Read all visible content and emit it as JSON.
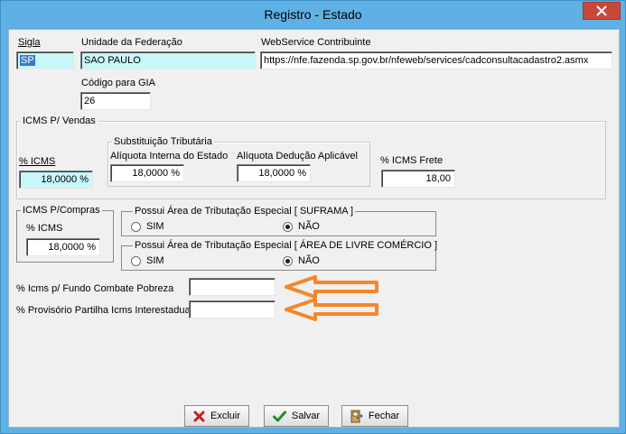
{
  "window": {
    "title": "Registro - Estado"
  },
  "fields": {
    "sigla": {
      "label": "Sigla",
      "value": "SP"
    },
    "uf": {
      "label": "Unidade da Federação",
      "value": "SAO PAULO"
    },
    "webservice": {
      "label": "WebService Contribuinte",
      "value": "https://nfe.fazenda.sp.gov.br/nfeweb/services/cadconsultacadastro2.asmx"
    },
    "codigo_gia": {
      "label": "Código para GIA",
      "value": "26"
    }
  },
  "icms_vendas": {
    "legend": "ICMS P/ Vendas",
    "pct_icms": {
      "label": "% ICMS",
      "value": "18,0000 %"
    },
    "subst": {
      "legend": "Substituição Tributária",
      "aliquota_interna": {
        "label": "Alíquota Interna do Estado",
        "value": "18,0000 %"
      },
      "aliquota_deducao": {
        "label": "Alíquota Dedução Aplicável",
        "value": "18,0000 %"
      }
    },
    "icms_frete": {
      "label": "% ICMS Frete",
      "value": "18,00"
    }
  },
  "icms_compras": {
    "legend": "ICMS P/Compras",
    "pct_icms": {
      "label": "% ICMS",
      "value": "18,0000 %"
    }
  },
  "suframa": {
    "legend": "Possui Área de Tributação Especial [ SUFRAMA ]",
    "sim": "SIM",
    "nao": "NÃO",
    "selected": "nao"
  },
  "livre_comercio": {
    "legend": "Possui Área de Tributação Especial [ ÁREA DE LIVRE COMÉRCIO ]",
    "sim": "SIM",
    "nao": "NÃO",
    "selected": "nao"
  },
  "fundo_pobreza": {
    "label": "% Icms p/ Fundo Combate Pobreza",
    "value": ""
  },
  "partilha": {
    "label": "% Provisório Partilha Icms Interestadual",
    "value": ""
  },
  "buttons": {
    "excluir": "Excluir",
    "salvar": "Salvar",
    "fechar": "Fechar"
  },
  "colors": {
    "titlebar": "#5fb0e4",
    "close": "#c7473a",
    "highlight_field": "#c8f7f9",
    "arrow": "#f5872a"
  }
}
